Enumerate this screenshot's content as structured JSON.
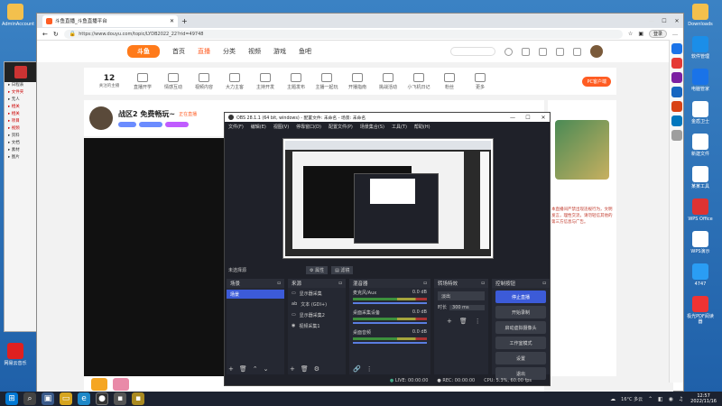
{
  "desktop": {
    "left_icons": [
      {
        "label": "AdminAccount"
      },
      {
        "label": "网易云音乐"
      }
    ],
    "right_icons": [
      {
        "label": "Downloads"
      },
      {
        "label": "软件管理"
      },
      {
        "label": "电脑管家"
      },
      {
        "label": "金盾卫士"
      },
      {
        "label": "新建文件"
      },
      {
        "label": "某某工具"
      },
      {
        "label": "WPS Office"
      },
      {
        "label": "WPS演示"
      },
      {
        "label": "4747"
      },
      {
        "label": "极光PDF阅读器"
      }
    ]
  },
  "browser": {
    "tab_title": "斗鱼直播_斗鱼直播平台",
    "url": "https://www.douyu.com/topic/LYDB2022_22?rid=49748",
    "login_label": "登录",
    "site_nav": [
      "首页",
      "直播",
      "分类",
      "视频",
      "游戏",
      "鱼吧"
    ],
    "follow_count": "12",
    "follow_label": "关注的主播",
    "categories": [
      "直播开学",
      "情感互动",
      "视频内容",
      "大力主客",
      "主持开发",
      "主题发布",
      "主播一起玩",
      "开播指南",
      "挑战活动",
      "小飞机日记",
      "粉丝",
      "更多"
    ],
    "streamer_title": "战区2 免费畅玩~",
    "streamer_tag": "正在直播",
    "pc_download": "PC客户端",
    "right_panel_text": "本直播间严禁出现违规行为，文明发言，理性交流，请勿轻信其他的第三方信息与广告。"
  },
  "obs": {
    "title": "OBS 28.1.1 (64 bit, windows) - 配置文件: 未命名 - 场景: 未命名",
    "menu": [
      "文件(F)",
      "编辑(E)",
      "视图(V)",
      "停靠窗口(D)",
      "配置文件(P)",
      "场景集合(S)",
      "工具(T)",
      "帮助(H)"
    ],
    "no_source": "未选择源",
    "props_btn": "属性",
    "filters_btn": "滤镜",
    "panels": {
      "scenes": "场景",
      "sources": "来源",
      "mixer": "混音器",
      "transitions": "转场特效",
      "controls": "控制按钮"
    },
    "scenes": [
      "场景"
    ],
    "sources": [
      "显示器采集",
      "文本 (GDI+)",
      "显示器采集2",
      "视频采集1"
    ],
    "mixer_channels": [
      {
        "name": "麦克风/Aux",
        "db": "0.0 dB"
      },
      {
        "name": "桌面采集设备",
        "db": "0.0 dB"
      },
      {
        "name": "桌面音频",
        "db": "0.0 dB"
      }
    ],
    "transition_type": "淡出",
    "duration_label": "时长",
    "duration_value": "300 ms",
    "controls": [
      "停止直播",
      "开始录制",
      "启动虚拟摄像头",
      "工作室模式",
      "设置",
      "退出"
    ],
    "status": {
      "live": "LIVE: 00:00:00",
      "rec": "REC: 00:00:00",
      "cpu": "CPU: 5.3%, 60.00 fps"
    }
  },
  "taskbar": {
    "weather": "16°C 多云",
    "time": "12:57",
    "date": "2022/11/16"
  },
  "colors": {
    "desktop_bg": "#2b6cb0",
    "obs_bg": "#1f2129",
    "obs_accent": "#3c5bd8",
    "douyu_orange": "#ff5d23"
  }
}
